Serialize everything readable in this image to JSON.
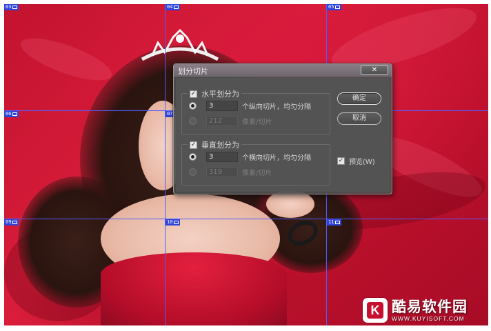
{
  "dialog": {
    "title": "划分切片",
    "close_glyph": "✕",
    "horizontal": {
      "label": "水平划分为",
      "checked": true,
      "option1": {
        "value": "3",
        "unit_label": "个纵向切片，均匀分隔",
        "selected": true
      },
      "option2": {
        "value": "212",
        "unit_label": "像素/切片",
        "selected": false
      }
    },
    "vertical": {
      "label": "垂直划分为",
      "checked": true,
      "option1": {
        "value": "3",
        "unit_label": "个横向切片，均匀分隔",
        "selected": true
      },
      "option2": {
        "value": "319",
        "unit_label": "像素/切片",
        "selected": false
      }
    },
    "ok_label": "确定",
    "cancel_label": "取消",
    "preview_label": "预览(W)",
    "preview_checked": true
  },
  "slices": {
    "labels": [
      "03",
      "04",
      "05",
      "06",
      "07",
      "09",
      "10",
      "11"
    ]
  },
  "watermark": {
    "logo_letter": "K",
    "name": "酷易软件园",
    "url": "WWW.KUYISOFT.COM"
  },
  "colors": {
    "backdrop_red": "#d81a3c",
    "slice_line": "#4f5dff",
    "slice_tag": "#2f44d8",
    "dialog_bg": "#535353"
  }
}
